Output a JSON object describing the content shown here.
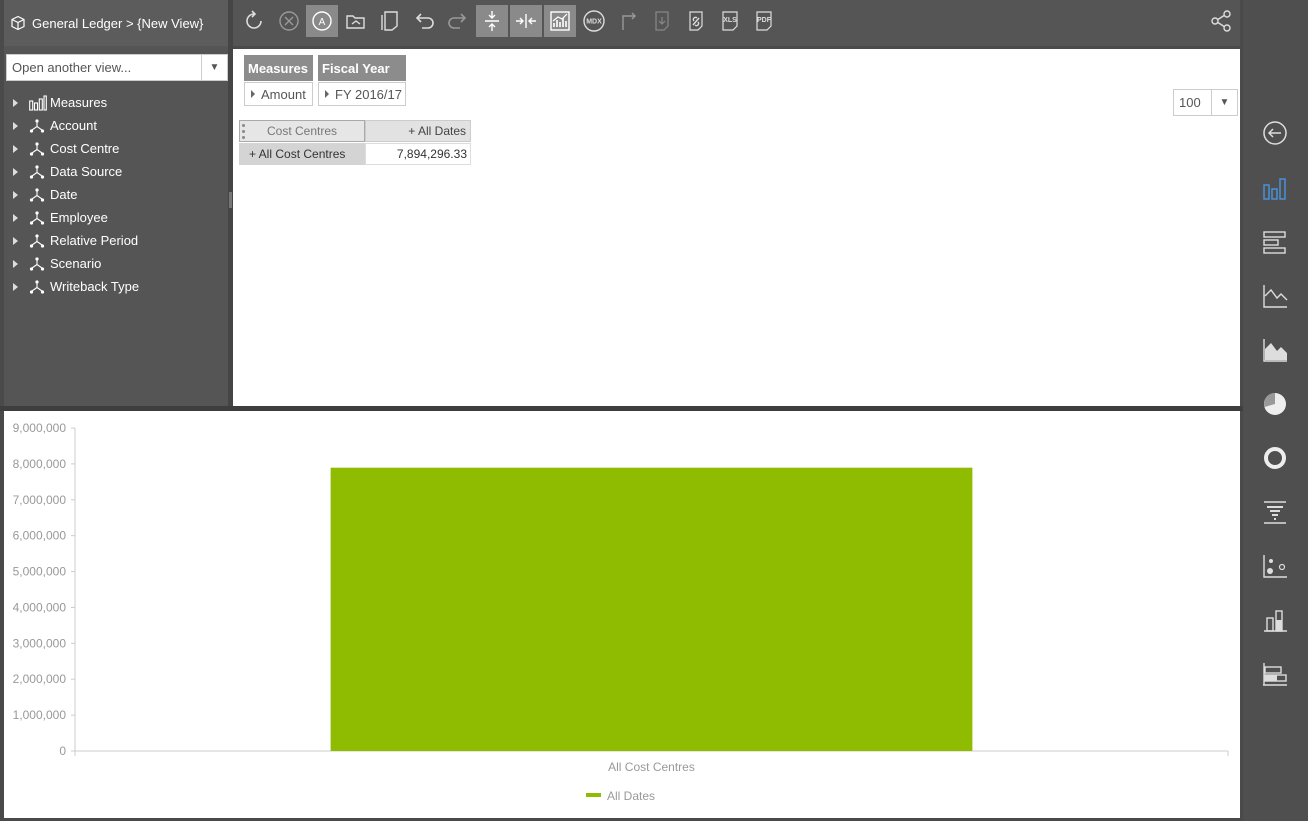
{
  "breadcrumb": {
    "text": "General Ledger > {New View}"
  },
  "view_select": {
    "placeholder": "Open another view..."
  },
  "dimensions": [
    {
      "label": "Measures",
      "icon": "measures-icon"
    },
    {
      "label": "Account",
      "icon": "hierarchy-icon"
    },
    {
      "label": "Cost Centre",
      "icon": "hierarchy-icon"
    },
    {
      "label": "Data Source",
      "icon": "hierarchy-icon"
    },
    {
      "label": "Date",
      "icon": "hierarchy-icon"
    },
    {
      "label": "Employee",
      "icon": "hierarchy-icon"
    },
    {
      "label": "Relative Period",
      "icon": "hierarchy-icon"
    },
    {
      "label": "Scenario",
      "icon": "hierarchy-icon"
    },
    {
      "label": "Writeback Type",
      "icon": "hierarchy-icon"
    }
  ],
  "toolbar": {
    "buttons": [
      "refresh-icon",
      "cancel-icon",
      "auto-query-icon",
      "open-view-icon",
      "save-view-icon",
      "undo-icon",
      "redo-icon",
      "collapse-icon",
      "expand-icon",
      "chart-grid-icon",
      "mdx-icon",
      "swap-axes-icon",
      "export-icon",
      "link-icon",
      "xls-icon",
      "pdf-icon",
      "share-icon"
    ],
    "mdx_label": "MDX",
    "xls_label": "XLS",
    "pdf_label": "PDF",
    "auto_label": "A"
  },
  "slicers": [
    {
      "header": "Measures",
      "value": "Amount"
    },
    {
      "header": "Fiscal Year",
      "value": "FY 2016/17"
    }
  ],
  "row_limit": {
    "value": "100"
  },
  "pivot": {
    "row_header": "Cost Centres",
    "col_header": "+ All Dates",
    "row_label": "+ All Cost Centres",
    "cell_value": "7,894,296.33"
  },
  "chart_data": {
    "type": "bar",
    "categories": [
      "All Cost Centres"
    ],
    "series": [
      {
        "name": "All Dates",
        "values": [
          7894296.33
        ]
      }
    ],
    "ylim": [
      0,
      9000000
    ],
    "yticks": [
      0,
      1000000,
      2000000,
      3000000,
      4000000,
      5000000,
      6000000,
      7000000,
      8000000,
      9000000
    ],
    "ytick_labels": [
      "0",
      "1,000,000",
      "2,000,000",
      "3,000,000",
      "4,000,000",
      "5,000,000",
      "6,000,000",
      "7,000,000",
      "8,000,000",
      "9,000,000"
    ],
    "legend_position": "bottom",
    "bar_color": "#8fbc00"
  },
  "chart_types": [
    "back-icon",
    "column-chart-icon",
    "bar-chart-icon",
    "line-chart-icon",
    "area-chart-icon",
    "pie-chart-icon",
    "doughnut-chart-icon",
    "funnel-chart-icon",
    "scatter-chart-icon",
    "stacked-column-icon",
    "stacked-bar-icon"
  ]
}
